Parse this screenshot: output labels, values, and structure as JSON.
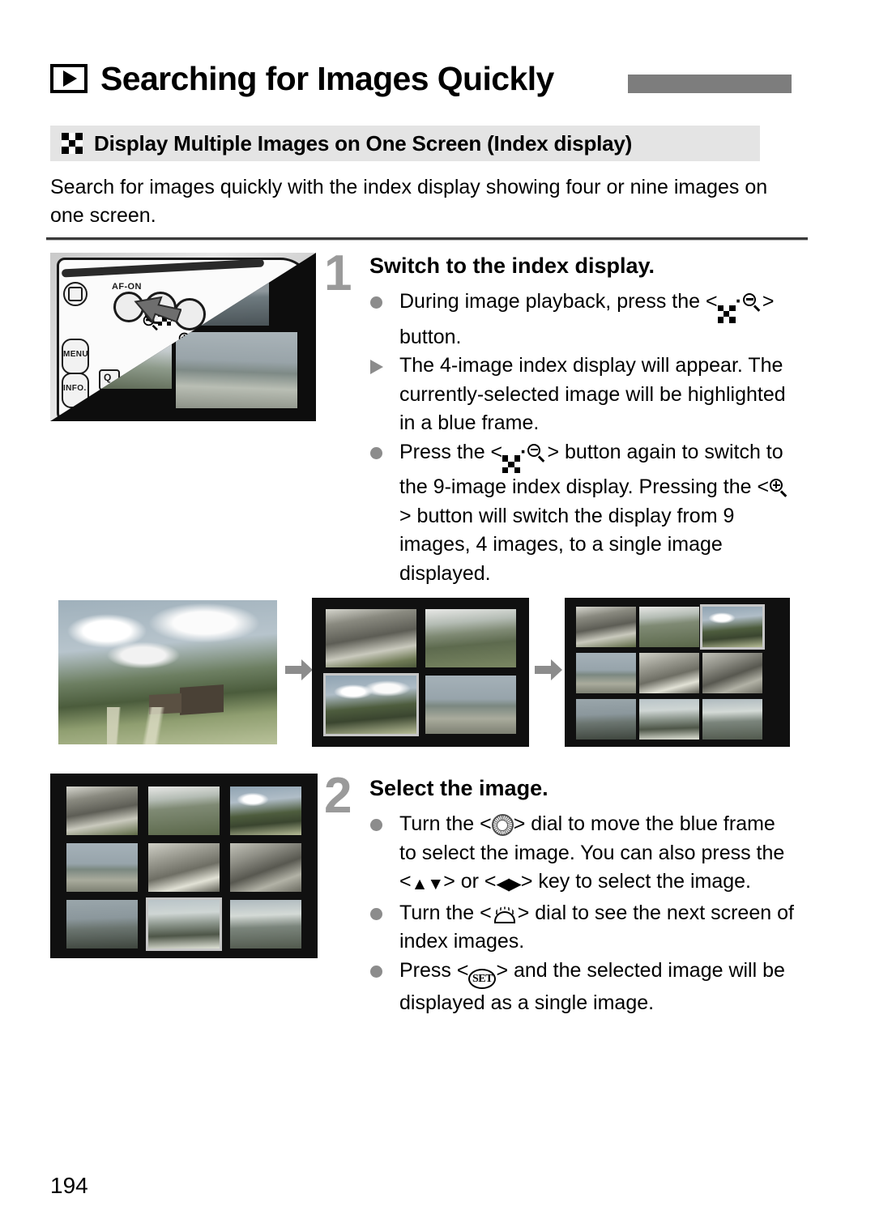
{
  "page": {
    "number": "194",
    "title": "Searching for Images Quickly",
    "title_icon": "playback-icon",
    "accent_gray": "#7d7d7d",
    "band_gray": "#e4e4e4"
  },
  "section": {
    "icon": "index-display-icon",
    "title": "Display Multiple Images on One Screen (Index display)",
    "intro": "Search for images quickly with the index display showing four or nine images on one screen."
  },
  "steps": [
    {
      "number": "1",
      "title": "Switch to the index display.",
      "bullets": [
        {
          "marker": "dot",
          "parts": [
            {
              "t": "text",
              "v": "During image playback, press the < "
            },
            {
              "t": "icon",
              "v": "index-magnify-minus-icon"
            },
            {
              "t": "text",
              "v": " > button."
            }
          ],
          "plain": "During image playback, press the <index/magnify-minus> button."
        },
        {
          "marker": "triangle",
          "parts": [
            {
              "t": "text",
              "v": "The 4-image index display will appear. The currently-selected image will be highlighted in a blue frame."
            }
          ],
          "plain": "The 4-image index display will appear. The currently-selected image will be highlighted in a blue frame."
        },
        {
          "marker": "dot",
          "parts": [
            {
              "t": "text",
              "v": "Press the < "
            },
            {
              "t": "icon",
              "v": "index-magnify-minus-icon"
            },
            {
              "t": "text",
              "v": " > button again to switch to the 9-image index display. Pressing the < "
            },
            {
              "t": "icon",
              "v": "magnify-plus-icon"
            },
            {
              "t": "text",
              "v": " > button will switch the display from 9 images, 4 images, to a single image displayed."
            }
          ],
          "plain": "Press the <index/magnify-minus> button again to switch to the 9-image index display. Pressing the <magnify-plus> button will switch the display from 9 images, 4 images, to a single image displayed."
        }
      ]
    },
    {
      "number": "2",
      "title": "Select the image.",
      "bullets": [
        {
          "marker": "dot",
          "parts": [
            {
              "t": "text",
              "v": "Turn the < "
            },
            {
              "t": "icon",
              "v": "quick-control-dial-icon"
            },
            {
              "t": "text",
              "v": " > dial to move the blue frame to select the image. You can also press the < "
            },
            {
              "t": "icon",
              "v": "up-down-key-icon"
            },
            {
              "t": "text",
              "v": " > or < "
            },
            {
              "t": "icon",
              "v": "left-right-key-icon"
            },
            {
              "t": "text",
              "v": " > key to select the image."
            }
          ],
          "plain": "Turn the <Quick Control dial> dial to move the blue frame to select the image. You can also press the <up-down> or <left-right> key to select the image."
        },
        {
          "marker": "dot",
          "parts": [
            {
              "t": "text",
              "v": "Turn the < "
            },
            {
              "t": "icon",
              "v": "main-dial-icon"
            },
            {
              "t": "text",
              "v": " > dial to see the next screen of index images."
            }
          ],
          "plain": "Turn the <Main dial> dial to see the next screen of index images."
        },
        {
          "marker": "dot",
          "parts": [
            {
              "t": "text",
              "v": "Press < "
            },
            {
              "t": "icon",
              "v": "set-button-icon"
            },
            {
              "t": "text",
              "v": " > and the selected image will be displayed as a single image."
            }
          ],
          "plain": "Press <SET> and the selected image will be displayed as a single image."
        }
      ]
    }
  ],
  "camera_illustration": {
    "name": "camera-back-controls",
    "labels": {
      "af_on": "AF-ON",
      "menu": "MENU",
      "info": "INFO.",
      "quick": "Q"
    },
    "highlighted_button": "index-magnify-minus-button"
  },
  "sequence": {
    "arrow_glyph": "→",
    "frames": [
      {
        "name": "single-image-display",
        "count": 1,
        "selected_index": null
      },
      {
        "name": "four-image-index-display",
        "count": 4,
        "selected_index": 2
      },
      {
        "name": "nine-image-index-display",
        "count": 9,
        "selected_index": 2
      }
    ]
  },
  "nine_index_illustration": {
    "name": "nine-image-index-selected",
    "count": 9,
    "selected_index": 7
  },
  "set_label": "SET",
  "updown_glyph": "▲▼",
  "leftright_glyph": "◀▶"
}
